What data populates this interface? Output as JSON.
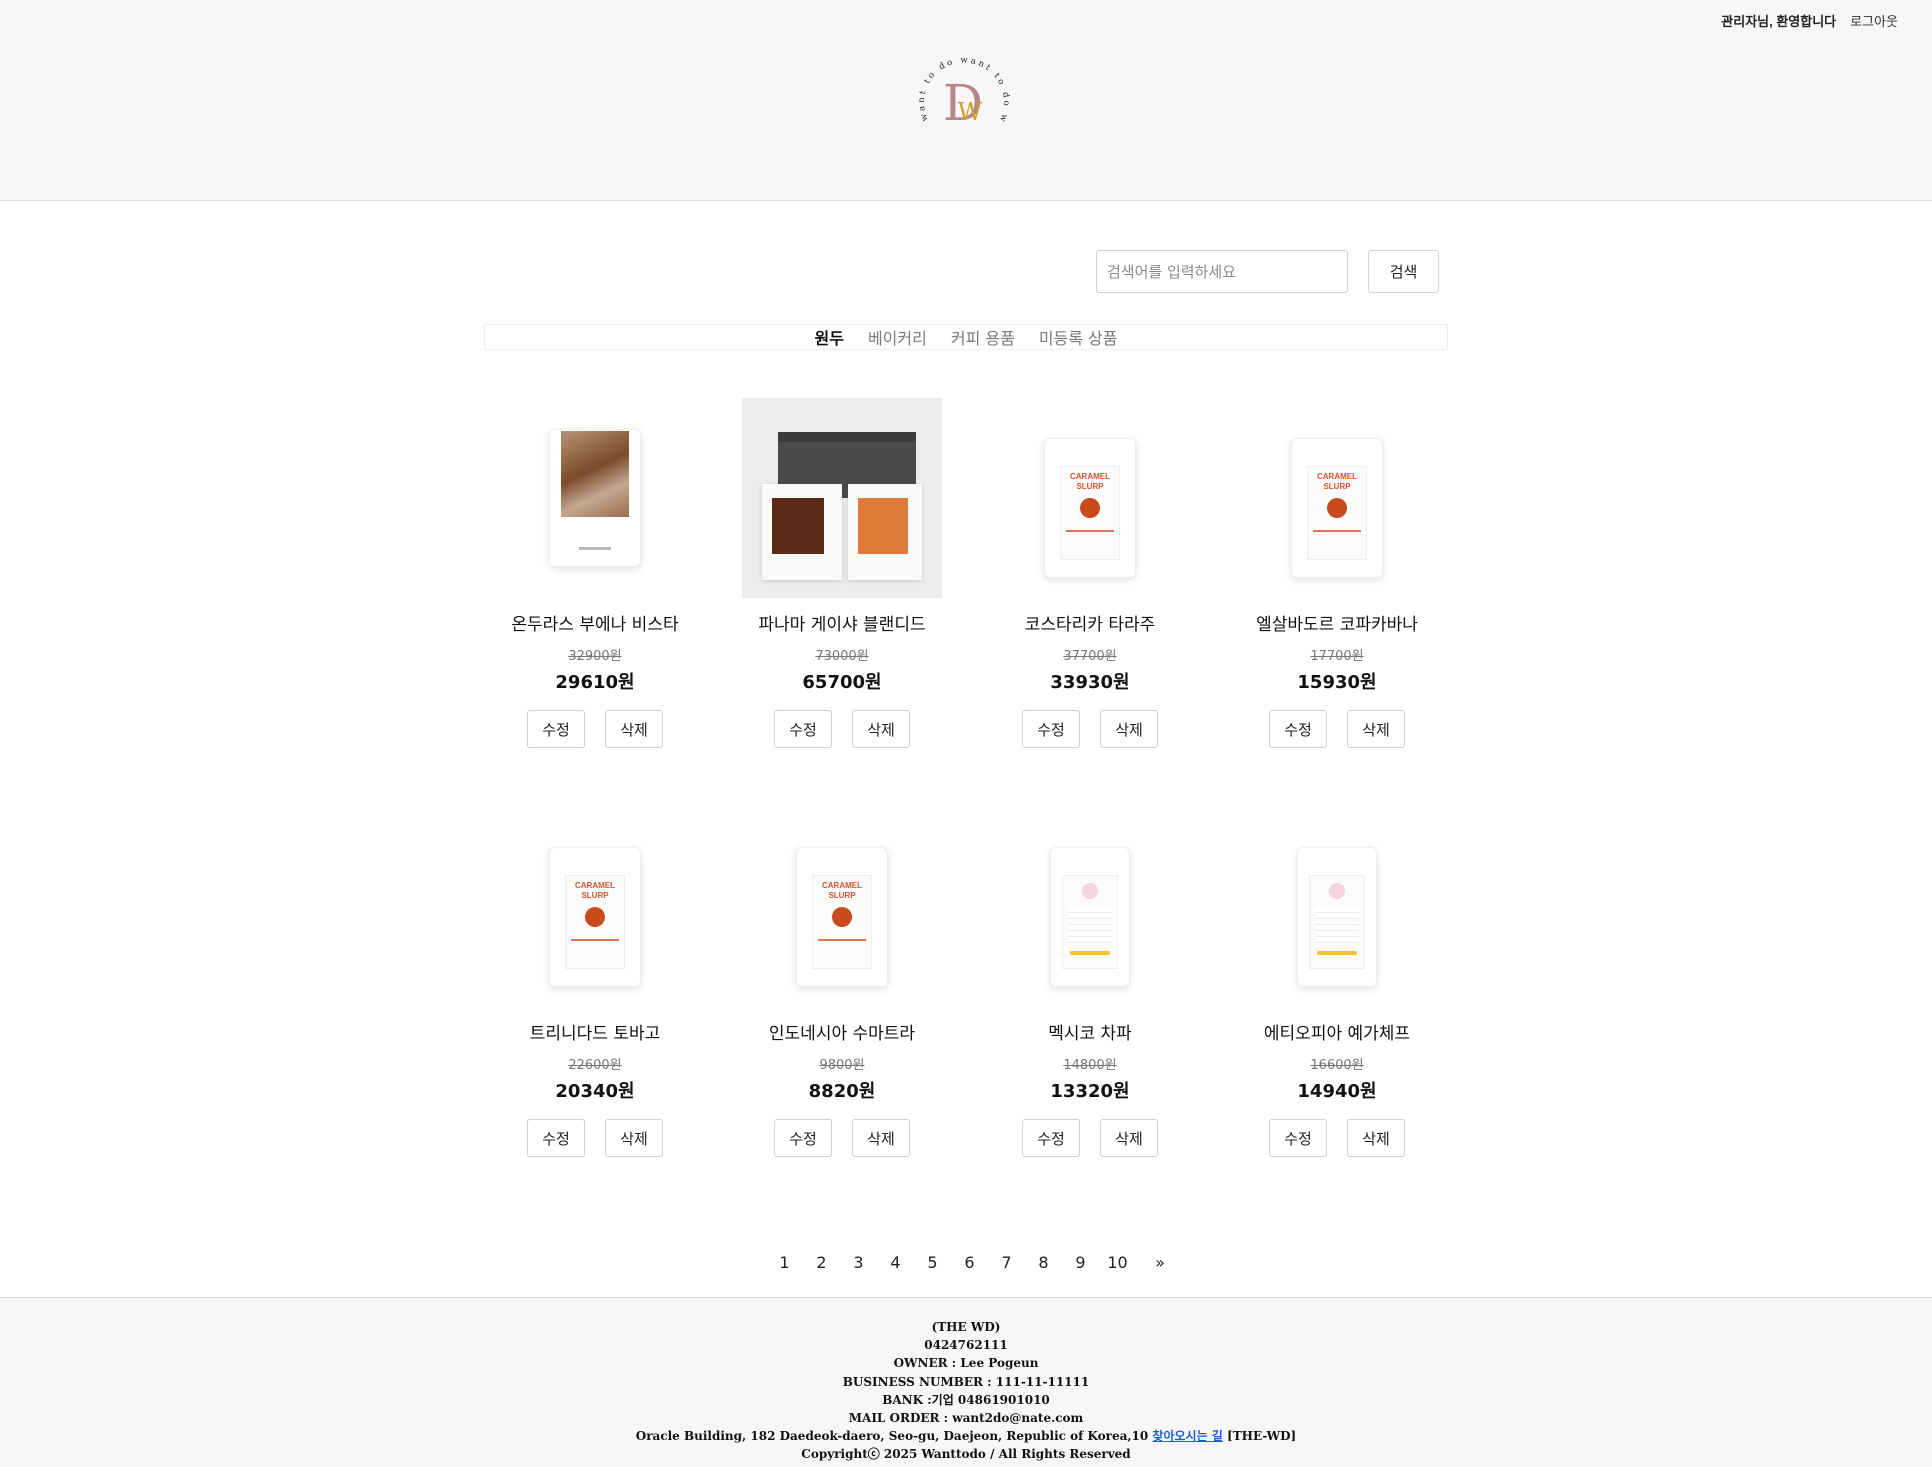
{
  "header": {
    "welcome": "관리자님, 환영합니다",
    "logout": "로그아웃",
    "logo_ring_text": "want to do want to do want to do",
    "logo_letters": "DW"
  },
  "search": {
    "placeholder": "검색어를 입력하세요",
    "button": "검색"
  },
  "categories": [
    "원두",
    "베이커리",
    "커피 용품",
    "미등록 상품"
  ],
  "active_category": "원두",
  "products": [
    {
      "name": "온두라스 부에나 비스타",
      "original_price": "32900원",
      "sale_price": "29610원",
      "edit": "수정",
      "delete": "삭제",
      "image": "brown-coffee-bag"
    },
    {
      "name": "파나마 게이샤 블랜디드",
      "original_price": "73000원",
      "sale_price": "65700원",
      "edit": "수정",
      "delete": "삭제",
      "image": "gift-box-set"
    },
    {
      "name": "코스타리카 타라주",
      "original_price": "37700원",
      "sale_price": "33930원",
      "edit": "수정",
      "delete": "삭제",
      "image": "caramel-slurp-bag"
    },
    {
      "name": "엘살바도르 코파카바나",
      "original_price": "17700원",
      "sale_price": "15930원",
      "edit": "수정",
      "delete": "삭제",
      "image": "caramel-slurp-bag"
    },
    {
      "name": "트리니다드 토바고",
      "original_price": "22600원",
      "sale_price": "20340원",
      "edit": "수정",
      "delete": "삭제",
      "image": "caramel-slurp-bag"
    },
    {
      "name": "인도네시아 수마트라",
      "original_price": "9800원",
      "sale_price": "8820원",
      "edit": "수정",
      "delete": "삭제",
      "image": "caramel-slurp-bag"
    },
    {
      "name": "멕시코 차파",
      "original_price": "14800원",
      "sale_price": "13320원",
      "edit": "수정",
      "delete": "삭제",
      "image": "decaf-bag"
    },
    {
      "name": "에티오피아 예가체프",
      "original_price": "16600원",
      "sale_price": "14940원",
      "edit": "수정",
      "delete": "삭제",
      "image": "decaf-bag"
    }
  ],
  "bag_label": {
    "caramel_line1": "CARAMEL",
    "caramel_line2": "SLURP"
  },
  "pagination": {
    "pages": [
      "1",
      "2",
      "3",
      "4",
      "5",
      "6",
      "7",
      "8",
      "9",
      "10"
    ],
    "next": "»"
  },
  "footer": {
    "company": "(THE WD)",
    "phone": "0424762111",
    "owner": "OWNER : Lee Pogeun",
    "business_number": "BUSINESS NUMBER : 111-11-11111",
    "bank": "BANK :기업 04861901010",
    "mail": "MAIL ORDER : want2do@nate.com",
    "address": "Oracle Building, 182 Daedeok-daero, Seo-gu, Daejeon, Republic of Korea,10",
    "directions_link": "찾아오시는 길",
    "address_suffix": "[THE-WD]",
    "copyright": "Copyrightⓒ 2025 Wanttodo / All Rights Reserved"
  },
  "colors": {
    "logo_d": "#b8868a",
    "logo_w": "#c9a227",
    "link": "#1a5fd0"
  }
}
